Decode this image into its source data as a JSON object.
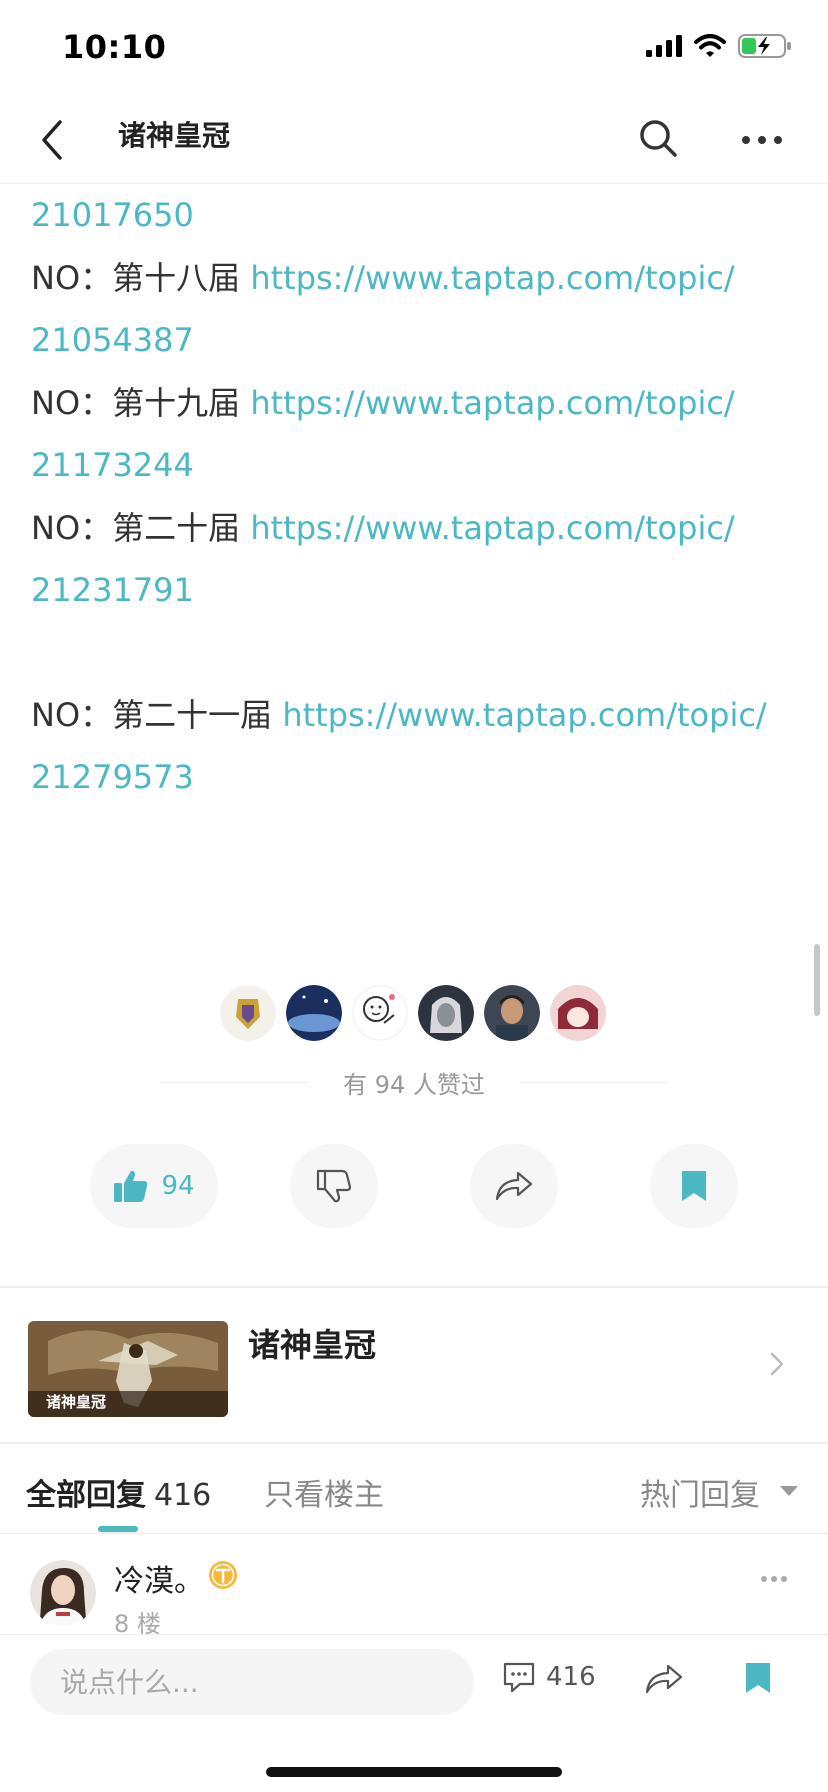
{
  "status_bar": {
    "time": "10:10"
  },
  "nav": {
    "title": "诸神皇冠"
  },
  "post_lines": [
    {
      "prefix": "",
      "link": "21017650"
    },
    {
      "prefix": "NO：第十八届 ",
      "link": "https://www.taptap.com/topic/"
    },
    {
      "prefix": "",
      "link": "21054387"
    },
    {
      "prefix": "NO：第十九届 ",
      "link": "https://www.taptap.com/topic/"
    },
    {
      "prefix": "",
      "link": "21173244"
    },
    {
      "prefix": "NO：第二十届 ",
      "link": "https://www.taptap.com/topic/"
    },
    {
      "prefix": "",
      "link": "21231791"
    },
    {
      "prefix": "NO：第二十一届 ",
      "link": "https://www.taptap.com/topic/"
    },
    {
      "prefix": "",
      "link": "21279573"
    }
  ],
  "likes": {
    "summary": "有 94 人赞过",
    "count": "94"
  },
  "app_card": {
    "name": "诸神皇冠",
    "thumb_caption": "诸神皇冠"
  },
  "reply_tabs": {
    "all_label": "全部回复",
    "all_count": "416",
    "op_only": "只看楼主",
    "sort": "热门回复"
  },
  "reply": {
    "user": "冷漠。",
    "floor": "8 楼"
  },
  "bottom_bar": {
    "placeholder": "说点什么...",
    "comment_count": "416"
  },
  "colors": {
    "accent": "#4cb8c4",
    "text": "#333333",
    "muted": "#999999"
  }
}
